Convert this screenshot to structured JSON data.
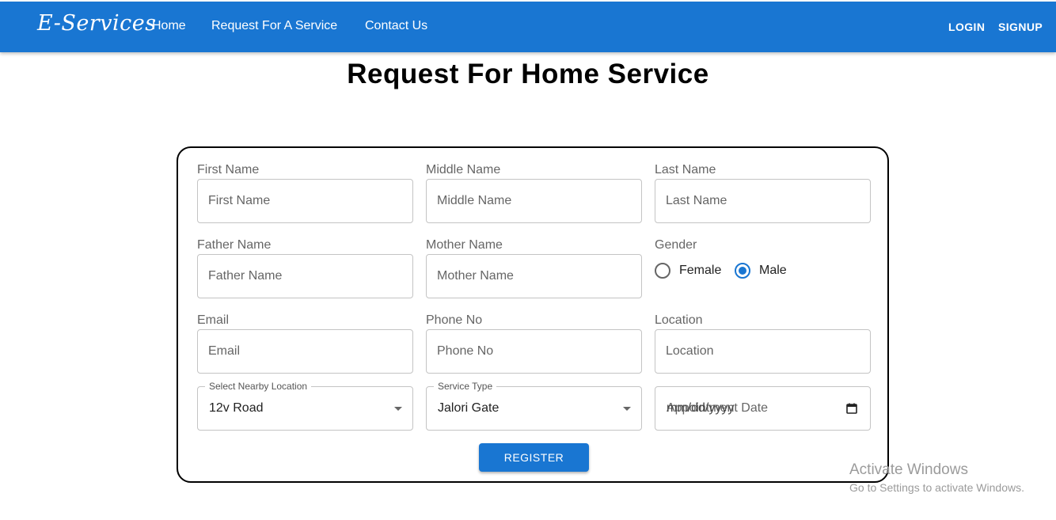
{
  "nav": {
    "brand": "E-Services",
    "links": [
      "Home",
      "Request For A Service",
      "Contact Us"
    ],
    "login": "LOGIN",
    "signup": "SIGNUP"
  },
  "page": {
    "title": "Request For Home Service"
  },
  "form": {
    "first_name": {
      "label": "First Name",
      "placeholder": "First Name",
      "value": ""
    },
    "middle_name": {
      "label": "Middle Name",
      "placeholder": "Middle Name",
      "value": ""
    },
    "last_name": {
      "label": "Last Name",
      "placeholder": "Last Name",
      "value": ""
    },
    "father_name": {
      "label": "Father Name",
      "placeholder": "Father Name",
      "value": ""
    },
    "mother_name": {
      "label": "Mother Name",
      "placeholder": "Mother Name",
      "value": ""
    },
    "gender": {
      "label": "Gender",
      "options": [
        "Female",
        "Male"
      ],
      "selected": "Male"
    },
    "email": {
      "label": "Email",
      "placeholder": "Email",
      "value": ""
    },
    "phone": {
      "label": "Phone No",
      "placeholder": "Phone No",
      "value": ""
    },
    "location": {
      "label": "Location",
      "placeholder": "Location",
      "value": ""
    },
    "nearby_location": {
      "label": "Select Nearby Location",
      "value": "12v Road"
    },
    "service_type": {
      "label": "Service Type",
      "value": "Jalori Gate"
    },
    "appointment_date": {
      "label": "Appointment Date",
      "format": "mm/dd/yyyy"
    },
    "register_label": "REGISTER"
  },
  "watermark": {
    "title": "Activate Windows",
    "subtitle": "Go to Settings to activate Windows."
  },
  "colors": {
    "primary": "#1976d2",
    "watermark": "#9b9b9b"
  },
  "icons": {
    "calendar": "calendar-icon",
    "dropdown": "chevron-down-icon"
  }
}
